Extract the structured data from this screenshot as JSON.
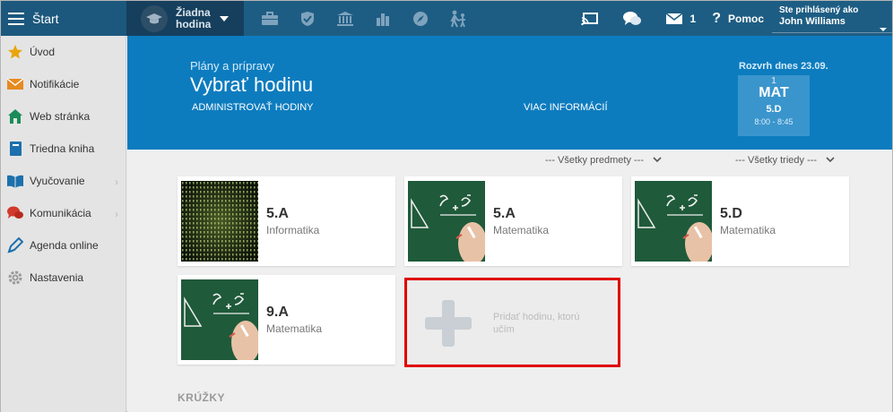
{
  "topbar": {
    "start_label": "Štart",
    "lesson_line1": "Žiadna",
    "lesson_line2": "hodina",
    "messages_count": "1",
    "help_label": "Pomoc",
    "logged_in_label": "Ste prihlásený ako",
    "user_name": "John Williams"
  },
  "sidebar": {
    "items": [
      {
        "label": "Úvod",
        "icon": "star-icon",
        "color": "#e8a50d"
      },
      {
        "label": "Notifikácie",
        "icon": "envelope-icon",
        "color": "#e58b20"
      },
      {
        "label": "Web stránka",
        "icon": "home-icon",
        "color": "#1a8c5a"
      },
      {
        "label": "Triedna kniha",
        "icon": "book-icon",
        "color": "#1d70ad"
      },
      {
        "label": "Vyučovanie",
        "icon": "open-book-icon",
        "color": "#1d70ad"
      },
      {
        "label": "Komunikácia",
        "icon": "chat-icon",
        "color": "#d23a2c"
      },
      {
        "label": "Agenda online",
        "icon": "pen-icon",
        "color": "#1d70ad"
      },
      {
        "label": "Nastavenia",
        "icon": "gear-icon",
        "color": "#9a9a9a"
      }
    ]
  },
  "header": {
    "subtitle": "Plány a prípravy",
    "title": "Vybrať hodinu",
    "admin_link": "ADMINISTROVAŤ HODINY",
    "info_link": "VIAC INFORMÁCIÍ",
    "schedule_label": "Rozvrh dnes 23.09.",
    "schedule": {
      "number": "1",
      "subject": "MAT",
      "class": "5.D",
      "time": "8:00 - 8:45"
    }
  },
  "filters": {
    "subjects": "--- Všetky predmety ---",
    "classes": "--- Všetky triedy ---"
  },
  "cards": [
    {
      "class": "5.A",
      "subject": "Informatika",
      "thumb": "matrix"
    },
    {
      "class": "5.A",
      "subject": "Matematika",
      "thumb": "chalkboard"
    },
    {
      "class": "5.D",
      "subject": "Matematika",
      "thumb": "chalkboard"
    },
    {
      "class": "9.A",
      "subject": "Matematika",
      "thumb": "chalkboard"
    }
  ],
  "add_card": {
    "label": "Pridať hodinu, ktorú učím"
  },
  "sections": {
    "clubs": "KRÚŽKY"
  },
  "colors": {
    "topbar": "#1e5d83",
    "header": "#0d7cbf",
    "highlight": "#e00000"
  }
}
